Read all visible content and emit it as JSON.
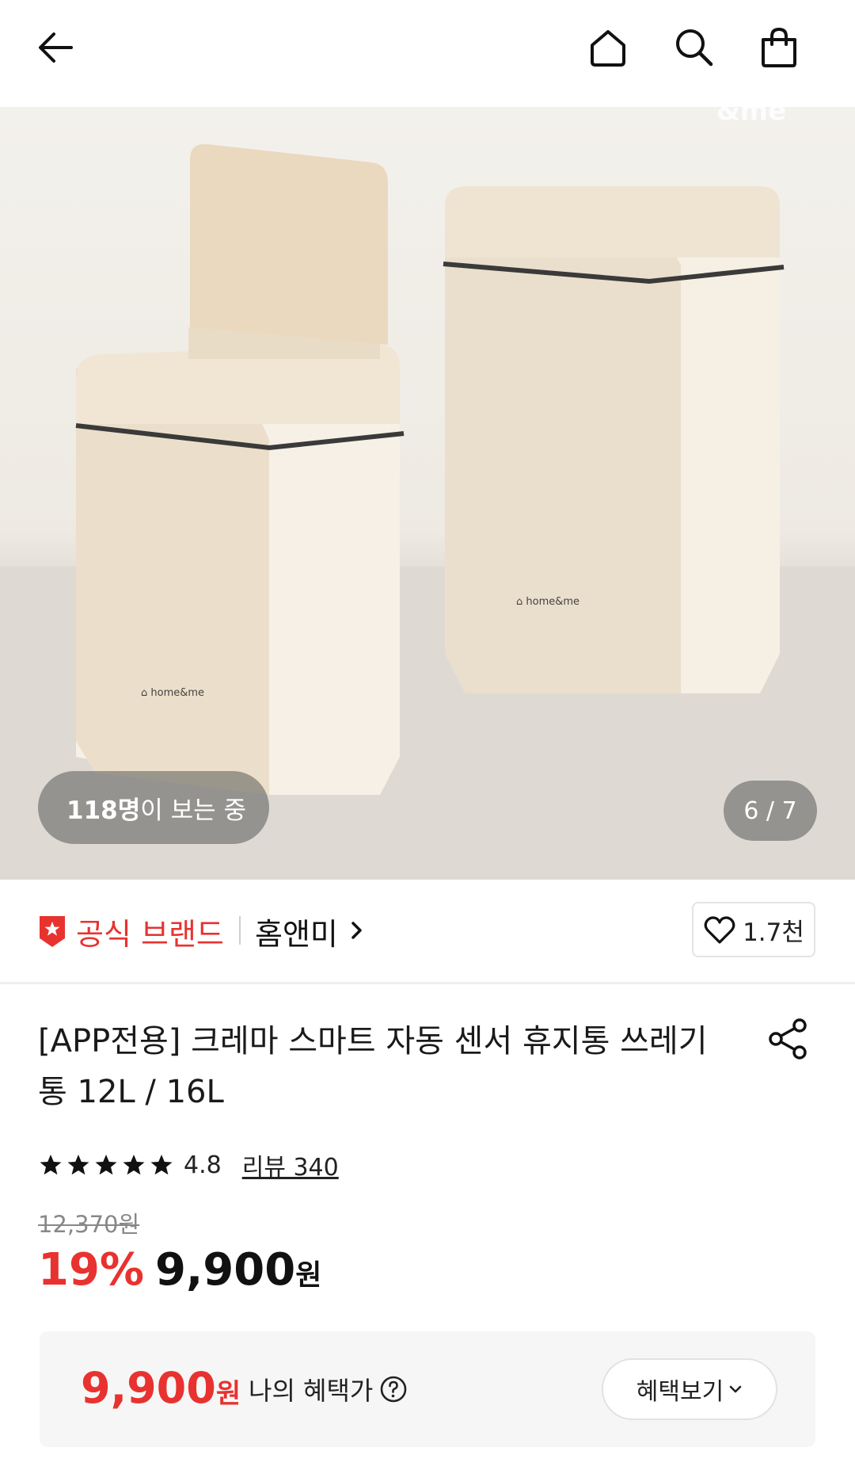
{
  "header": {
    "back_icon": "arrow-left-icon",
    "home_icon": "home-icon",
    "search_icon": "search-icon",
    "cart_icon": "shopping-bag-icon"
  },
  "gallery": {
    "viewer_count": "118명",
    "viewer_suffix": "이 보는 중",
    "page_indicator": "6 / 7",
    "product_logo_text": "home&me"
  },
  "brand": {
    "badge_label": "공식 브랜드",
    "name": "홈앤미",
    "like_count": "1.7천"
  },
  "product": {
    "title": "[APP전용] 크레마 스마트 자동 센서 휴지통 쓰레기통 12L / 16L",
    "rating": 4.8,
    "rating_text": "4.8",
    "stars": 5,
    "review_link": "리뷰 340"
  },
  "price": {
    "original": "12,370원",
    "discount": "19%",
    "amount": "9,900",
    "unit": "원"
  },
  "benefit": {
    "amount": "9,900",
    "unit": "원",
    "label": "나의 혜택가",
    "button_label": "혜택보기"
  },
  "colors": {
    "accent": "#e8322f",
    "text": "#111111",
    "muted": "#888888"
  }
}
